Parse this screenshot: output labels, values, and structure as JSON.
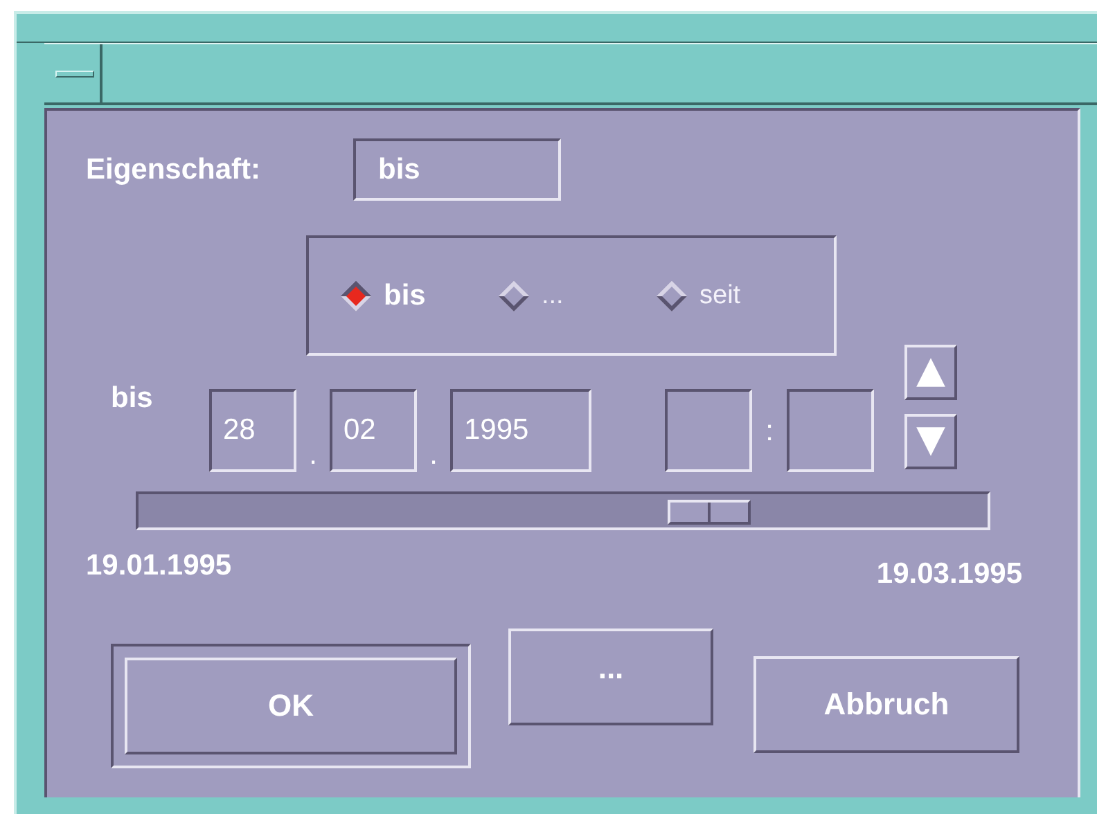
{
  "property": {
    "label": "Eigenschaft:",
    "value": "bis"
  },
  "options": [
    {
      "label": "bis",
      "selected": true,
      "disabled": false
    },
    {
      "label": "...",
      "selected": false,
      "disabled": true
    },
    {
      "label": "seit",
      "selected": false,
      "disabled": true
    }
  ],
  "date": {
    "label": "bis",
    "day": "28",
    "month": "02",
    "year": "1995",
    "sep1": ".",
    "sep2": ".",
    "time_sep": ":"
  },
  "slider": {
    "level": 0.69,
    "min_label": "19.01.1995",
    "max_label": "19.03.1995"
  },
  "buttons": [
    {
      "label": "OK",
      "default": true
    },
    {
      "label": "...",
      "default": false
    },
    {
      "label": "Abbruch",
      "default": false
    }
  ]
}
